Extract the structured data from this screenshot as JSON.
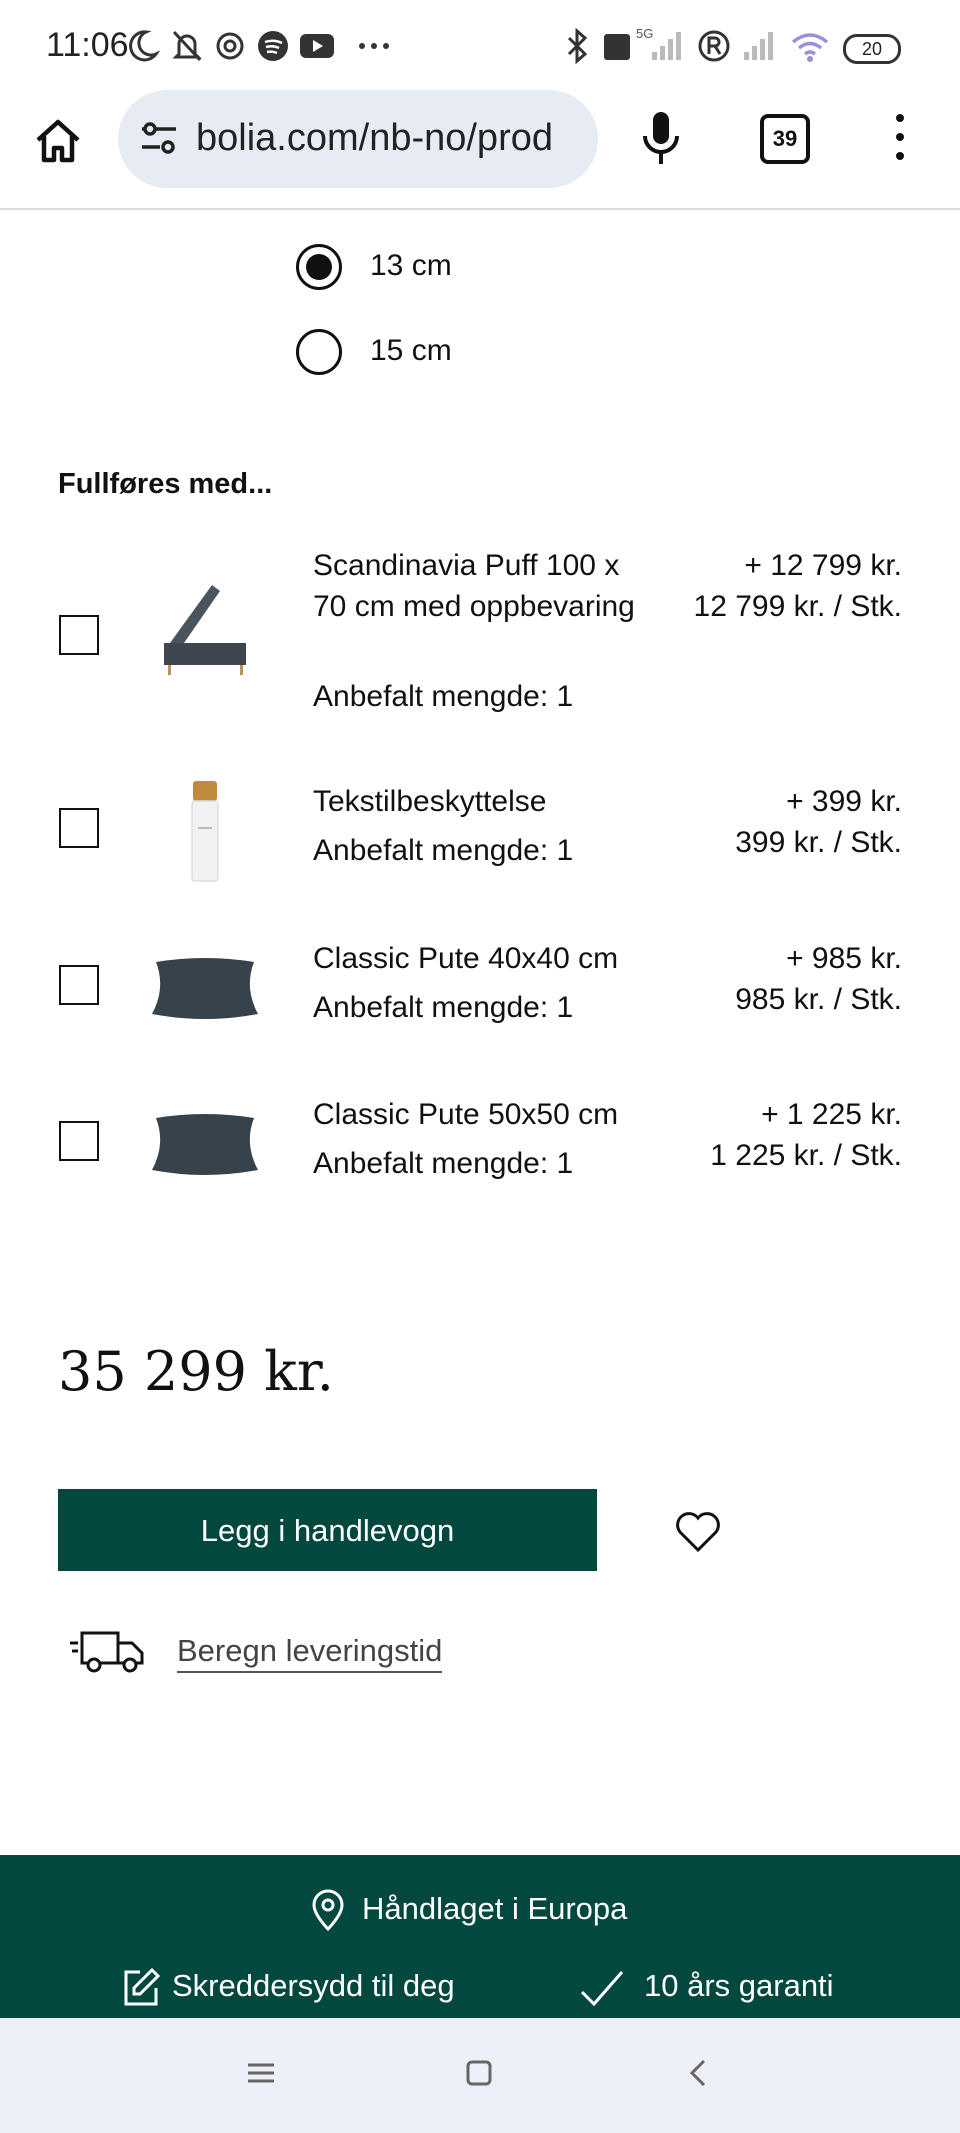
{
  "status_bar": {
    "time": "11:06",
    "network_label": "5G",
    "battery": "20"
  },
  "browser": {
    "url": "bolia.com/nb-no/prod",
    "tab_count": "39"
  },
  "size_options": [
    {
      "label": "13 cm",
      "selected": true
    },
    {
      "label": "15 cm",
      "selected": false
    }
  ],
  "section_title": "Fullføres med...",
  "products": [
    {
      "name": "Scandinavia Puff 100 x 70 cm med oppbevaring",
      "qty": "Anbefalt mengde: 1",
      "price_add": "+ 12 799 kr.",
      "price_unit": "12 799 kr. / Stk.",
      "checked": false,
      "thumb": "storage-ottoman"
    },
    {
      "name": "Tekstilbeskyttelse",
      "qty": "Anbefalt mengde: 1",
      "price_add": "+ 399 kr.",
      "price_unit": "399 kr. / Stk.",
      "checked": false,
      "thumb": "spray-bottle"
    },
    {
      "name": "Classic Pute 40x40 cm",
      "qty": "Anbefalt mengde: 1",
      "price_add": "+ 985 kr.",
      "price_unit": "985 kr. / Stk.",
      "checked": false,
      "thumb": "cushion"
    },
    {
      "name": "Classic Pute 50x50 cm",
      "qty": "Anbefalt mengde: 1",
      "price_add": "+ 1 225 kr.",
      "price_unit": "1 225 kr. / Stk.",
      "checked": false,
      "thumb": "cushion"
    }
  ],
  "total_price": "35 299 kr.",
  "add_to_cart_label": "Legg i handlevogn",
  "delivery_link": "Beregn leveringstid",
  "footer": {
    "made_in": "Håndlaget i Europa",
    "custom": "Skreddersydd til deg",
    "warranty": "10 års garanti"
  },
  "colors": {
    "brand_green": "#02483f",
    "url_bar_bg": "#e6ebf4",
    "nav_bar_bg": "#edf0f6"
  }
}
